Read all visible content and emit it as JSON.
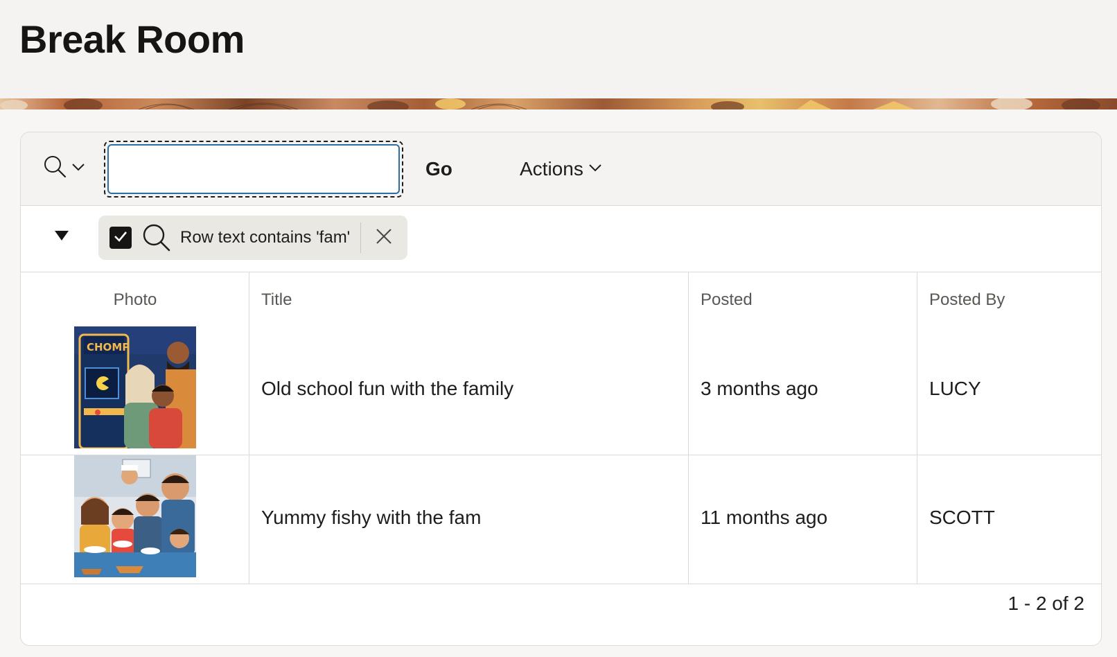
{
  "page": {
    "title": "Break Room"
  },
  "toolbar": {
    "search_value": "",
    "go_label": "Go",
    "actions_label": "Actions"
  },
  "filters": [
    {
      "label": "Row text contains 'fam'",
      "enabled": true
    }
  ],
  "table": {
    "columns": [
      "Photo",
      "Title",
      "Posted",
      "Posted By"
    ],
    "rows": [
      {
        "photo_icon": "arcade-family-photo",
        "title": "Old school fun with the family",
        "posted": "3 months ago",
        "posted_by": "LUCY"
      },
      {
        "photo_icon": "sushi-family-photo",
        "title": "Yummy fishy with the fam",
        "posted": "11 months ago",
        "posted_by": "SCOTT"
      }
    ]
  },
  "pagination": {
    "text": "1 - 2 of 2"
  },
  "thumb_text": {
    "arcade_marquee": "CHOMP"
  },
  "colors": {
    "accent_border": "#2c6ea3",
    "chip_bg": "#e9e8e3",
    "header_bg": "#f4f3f1"
  }
}
